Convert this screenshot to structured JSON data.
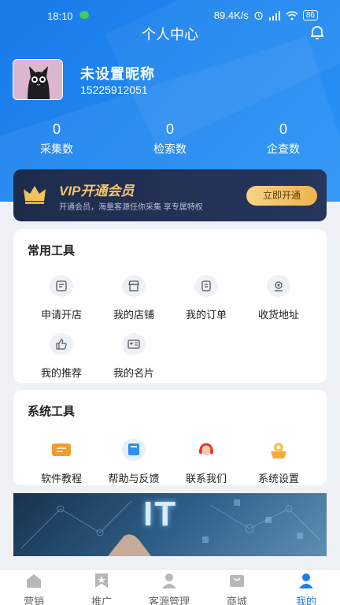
{
  "status_bar": {
    "time": "18:10",
    "network_speed": "89.4K/s",
    "battery": "86"
  },
  "header": {
    "title": "个人中心"
  },
  "profile": {
    "nickname": "未设置昵称",
    "phone": "15225912051"
  },
  "stats": [
    {
      "value": "0",
      "label": "采集数"
    },
    {
      "value": "0",
      "label": "检索数"
    },
    {
      "value": "0",
      "label": "企查数"
    }
  ],
  "vip": {
    "title": "VIP开通会员",
    "description": "开通会员，海量客源任你采集 享专属特权",
    "button": "立即开通"
  },
  "common_tools": {
    "title": "常用工具",
    "items": [
      {
        "label": "申请开店",
        "icon": "shop-apply-icon"
      },
      {
        "label": "我的店铺",
        "icon": "store-icon"
      },
      {
        "label": "我的订单",
        "icon": "order-icon"
      },
      {
        "label": "收货地址",
        "icon": "location-icon"
      },
      {
        "label": "我的推荐",
        "icon": "thumbs-up-icon"
      },
      {
        "label": "我的名片",
        "icon": "business-card-icon"
      }
    ]
  },
  "system_tools": {
    "title": "系统工具",
    "items": [
      {
        "label": "软件教程",
        "icon": "tutorial-icon"
      },
      {
        "label": "帮助与反馈",
        "icon": "help-book-icon"
      },
      {
        "label": "联系我们",
        "icon": "headset-icon"
      },
      {
        "label": "系统设置",
        "icon": "settings-icon"
      }
    ]
  },
  "banner": {
    "text": "IT"
  },
  "tabbar": [
    {
      "label": "营销",
      "icon": "home-icon",
      "active": false
    },
    {
      "label": "推广",
      "icon": "star-flag-icon",
      "active": false
    },
    {
      "label": "客源管理",
      "icon": "users-icon",
      "active": false
    },
    {
      "label": "商城",
      "icon": "mall-icon",
      "active": false
    },
    {
      "label": "我的",
      "icon": "user-icon",
      "active": true
    }
  ],
  "colors": {
    "primary": "#1e7cf0",
    "vip_gold": "#f5c56a",
    "vip_bg": "#1e2c4c"
  }
}
